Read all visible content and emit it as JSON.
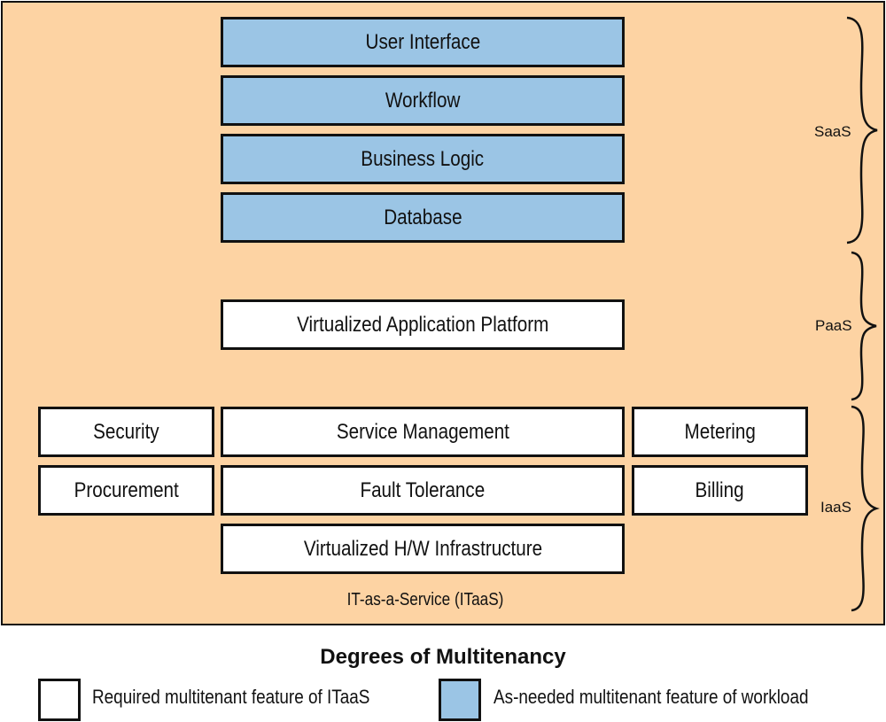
{
  "colors": {
    "background": "#fdd3a3",
    "workload": "#9bc5e5",
    "itaas": "#ffffff",
    "stroke": "#111111"
  },
  "layers": {
    "saas": [
      "User Interface",
      "Workflow",
      "Business Logic",
      "Database"
    ],
    "paas": [
      "Virtualized Application Platform"
    ],
    "iaas": {
      "left": [
        "Security",
        "Procurement"
      ],
      "center": [
        "Service Management",
        "Fault Tolerance",
        "Virtualized H/W Infrastructure"
      ],
      "right": [
        "Metering",
        "Billing"
      ]
    }
  },
  "footer_label": "IT-as-a-Service (ITaaS)",
  "braces": {
    "saas": "SaaS",
    "paas": "PaaS",
    "iaas": "IaaS"
  },
  "legend": {
    "title": "Degrees of Multitenancy",
    "items": [
      {
        "label": "Required multitenant feature of ITaaS",
        "type": "itaas"
      },
      {
        "label": "As-needed multitenant feature of workload",
        "type": "workload"
      }
    ]
  }
}
